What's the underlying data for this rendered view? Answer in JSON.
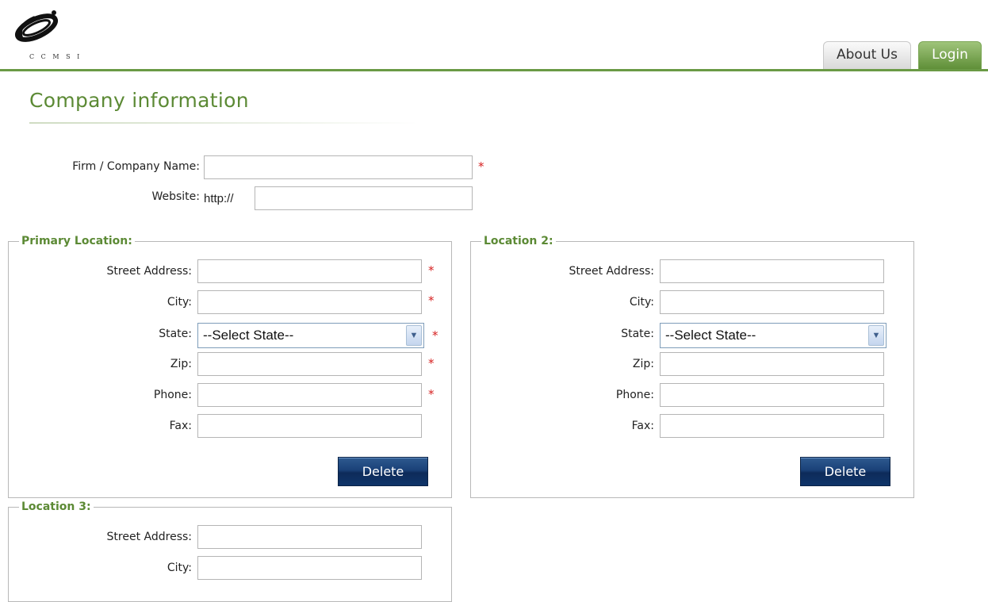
{
  "logo": {
    "text": "C C M S I"
  },
  "nav": {
    "about_label": "About Us",
    "login_label": "Login"
  },
  "page_title": "Company information",
  "company": {
    "name_label": "Firm / Company Name:",
    "name_value": "",
    "website_label": "Website:",
    "website_prefix": "http://",
    "website_value": ""
  },
  "required_marker": "*",
  "locations": [
    {
      "legend": "Primary Location:",
      "street_label": "Street Address:",
      "city_label": "City:",
      "state_label": "State:",
      "state_value": "--Select State--",
      "zip_label": "Zip:",
      "phone_label": "Phone:",
      "fax_label": "Fax:",
      "delete_label": "Delete"
    },
    {
      "legend": "Location 2:",
      "street_label": "Street Address:",
      "city_label": "City:",
      "state_label": "State:",
      "state_value": "--Select State--",
      "zip_label": "Zip:",
      "phone_label": "Phone:",
      "fax_label": "Fax:",
      "delete_label": "Delete"
    },
    {
      "legend": "Location 3:",
      "street_label": "Street Address:",
      "city_label": "City:"
    }
  ],
  "colors": {
    "brand_green": "#5c8a35",
    "required_red": "#d62020",
    "button_blue": "#1a4178"
  }
}
